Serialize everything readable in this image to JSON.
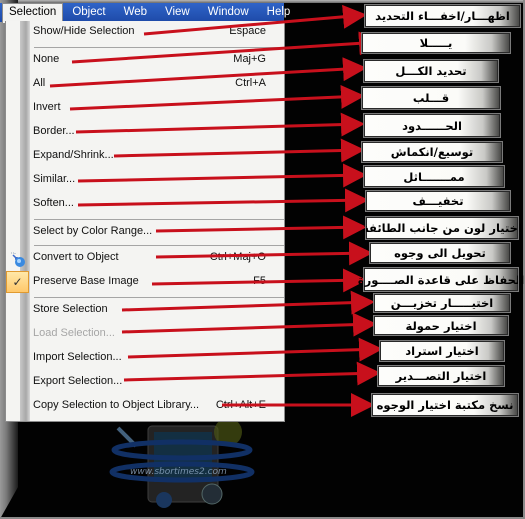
{
  "menubar": {
    "items": [
      {
        "label": "Selection",
        "active": true
      },
      {
        "label": "Object"
      },
      {
        "label": "Web"
      },
      {
        "label": "View"
      },
      {
        "label": "Window"
      },
      {
        "label": "Help"
      }
    ]
  },
  "menu": {
    "items": [
      {
        "label": "Show/Hide Selection",
        "shortcut": "Espace",
        "annotation": "اظهـــار/اخفـــاء التحديد"
      },
      {
        "label": "None",
        "shortcut": "Maj+G",
        "annotation": "يـــــلا"
      },
      {
        "label": "All",
        "shortcut": "Ctrl+A",
        "annotation": "تحديد الكـــل"
      },
      {
        "label": "Invert",
        "shortcut": "",
        "annotation": "قـــلب"
      },
      {
        "label": "Border...",
        "shortcut": "",
        "annotation": "الحــــــدود"
      },
      {
        "label": "Expand/Shrink...",
        "shortcut": "",
        "annotation": "توسيع/انكماش"
      },
      {
        "label": "Similar...",
        "shortcut": "",
        "annotation": "ممـــــــاثل"
      },
      {
        "label": "Soften...",
        "shortcut": "",
        "annotation": "تخفيـــف"
      },
      {
        "label": "Select by Color Range...",
        "shortcut": "",
        "annotation": "اختيار لون من جانب الطائفة"
      },
      {
        "label": "Convert to Object",
        "shortcut": "Ctrl+Maj+O",
        "annotation": "تحويل الى وجوه",
        "icon": "convert-icon"
      },
      {
        "label": "Preserve Base Image",
        "shortcut": "F5",
        "annotation": "الحفاظ على قاعدة الصــــورة",
        "checked": true
      },
      {
        "label": "Store Selection",
        "shortcut": "",
        "annotation": "اختيـــــار تخزيـــن"
      },
      {
        "label": "Load Selection...",
        "shortcut": "",
        "annotation": "اختيار حمولة",
        "disabled": true
      },
      {
        "label": "Import Selection...",
        "shortcut": "",
        "annotation": "اختيار استراد"
      },
      {
        "label": "Export Selection...",
        "shortcut": "",
        "annotation": "اختيار التصـــدير"
      },
      {
        "label": "Copy Selection to Object Library...",
        "shortcut": "Ctrl+Alt+E",
        "annotation": "نسخ مكتبة اختيار الوجوه"
      }
    ]
  },
  "watermark": {
    "text": "www.sbortimes2.com"
  },
  "colors": {
    "arrow": "#c8101c",
    "menubar": "#2455b8",
    "check_bg": "#ffd27f"
  }
}
